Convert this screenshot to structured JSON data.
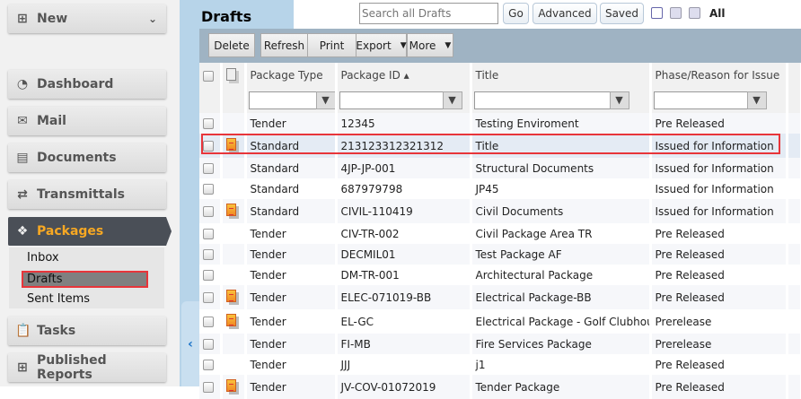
{
  "sidebar": {
    "new_label": "New",
    "items": [
      {
        "label": "Dashboard",
        "icon": "dashboard-icon"
      },
      {
        "label": "Mail",
        "icon": "mail-icon"
      },
      {
        "label": "Documents",
        "icon": "documents-icon"
      },
      {
        "label": "Transmittals",
        "icon": "transmittals-icon"
      },
      {
        "label": "Packages",
        "icon": "gift-icon"
      },
      {
        "label": "Tasks",
        "icon": "tasks-icon"
      },
      {
        "label": "Published Reports",
        "icon": "grid-icon"
      }
    ],
    "packages_sub": [
      "Inbox",
      "Drafts",
      "Sent Items"
    ]
  },
  "header": {
    "title": "Drafts",
    "search_placeholder": "Search all Drafts",
    "go": "Go",
    "advanced": "Advanced",
    "saved": "Saved",
    "all": "All"
  },
  "toolbar": {
    "delete": "Delete",
    "refresh": "Refresh",
    "print": "Print",
    "export": "Export",
    "more": "More"
  },
  "columns": [
    "Package Type",
    "Package ID ▴",
    "Title",
    "Phase/Reason for Issue"
  ],
  "rows": [
    {
      "type": "Tender",
      "id": "12345",
      "title": "Testing Enviroment",
      "phase": "Pre Released",
      "icon": false
    },
    {
      "type": "Standard",
      "id": "213123312321312",
      "title": "Title",
      "phase": "Issued for Information",
      "icon": true
    },
    {
      "type": "Standard",
      "id": "4JP-JP-001",
      "title": "Structural Documents",
      "phase": "Issued for Information",
      "icon": false
    },
    {
      "type": "Standard",
      "id": "687979798",
      "title": "JP45",
      "phase": "Issued for Information",
      "icon": false
    },
    {
      "type": "Standard",
      "id": "CIVIL-110419",
      "title": "Civil Documents",
      "phase": "Issued for Information",
      "icon": true
    },
    {
      "type": "Tender",
      "id": "CIV-TR-002",
      "title": "Civil Package Area TR",
      "phase": "Pre Released",
      "icon": false
    },
    {
      "type": "Tender",
      "id": "DECMIL01",
      "title": "Test Package AF",
      "phase": "Pre Released",
      "icon": false
    },
    {
      "type": "Tender",
      "id": "DM-TR-001",
      "title": "Architectural Package",
      "phase": "Pre Released",
      "icon": false
    },
    {
      "type": "Tender",
      "id": "ELEC-071019-BB",
      "title": "Electrical Package-BB",
      "phase": "Pre Released",
      "icon": true
    },
    {
      "type": "Tender",
      "id": "EL-GC",
      "title": "Electrical Package - Golf Clubhouse",
      "phase": "Prerelease",
      "icon": true
    },
    {
      "type": "Tender",
      "id": "FI-MB",
      "title": "Fire Services Package",
      "phase": "Prerelease",
      "icon": false
    },
    {
      "type": "Tender",
      "id": "JJJ",
      "title": "j1",
      "phase": "Pre Released",
      "icon": false
    },
    {
      "type": "Tender",
      "id": "JV-COV-01072019",
      "title": "Tender Package",
      "phase": "Pre Released",
      "icon": true
    }
  ]
}
